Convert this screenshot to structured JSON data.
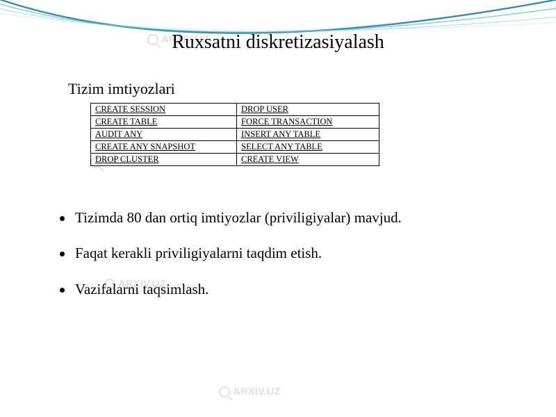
{
  "title": "Ruxsatni diskretizasiyalash",
  "subtitle": "Tizim imtiyozlari",
  "watermark_text": "ARXIV.UZ",
  "privileges": {
    "rows": [
      {
        "left": "CREATE SESSION",
        "right": "DROP USER"
      },
      {
        "left": "CREATE TABLE",
        "right": " FORCE TRANSACTION"
      },
      {
        "left": "AUDIT ANY",
        "right": " INSERT ANY TABLE"
      },
      {
        "left": " CREATE ANY SNAPSHOT",
        "right": " SELECT ANY TABLE"
      },
      {
        "left": "DROP CLUSTER",
        "right": "CREATE VIEW"
      }
    ]
  },
  "bullets": [
    "Tizimda 80 dan ortiq imtiyozlar (priviligiyalar) mavjud.",
    "Faqat kerakli priviligiyalarni taqdim etish.",
    "Vazifalarni taqsimlash."
  ]
}
